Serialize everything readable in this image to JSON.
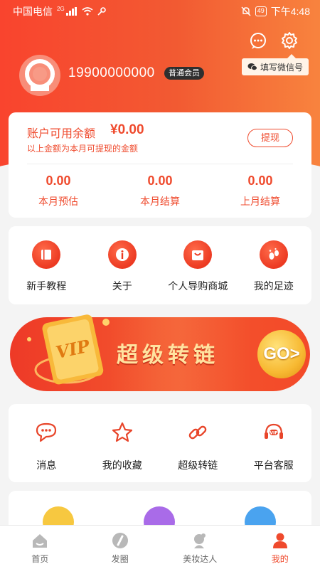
{
  "status_bar": {
    "carrier": "中国电信",
    "network": "2G",
    "battery": "49",
    "time": "下午4:48"
  },
  "header": {
    "wechat_button_label": "填写微信号",
    "phone": "19900000000",
    "member_badge": "普通会员"
  },
  "balance": {
    "title": "账户可用余额",
    "amount": "¥0.00",
    "note": "以上金额为本月可提现的金额",
    "withdraw_label": "提现",
    "stats": [
      {
        "value": "0.00",
        "label": "本月预估"
      },
      {
        "value": "0.00",
        "label": "本月结算"
      },
      {
        "value": "0.00",
        "label": "上月结算"
      }
    ]
  },
  "menu_top": [
    {
      "label": "新手教程",
      "icon": "book-icon"
    },
    {
      "label": "关于",
      "icon": "info-icon"
    },
    {
      "label": "个人导购商城",
      "icon": "shopping-bag-icon"
    },
    {
      "label": "我的足迹",
      "icon": "footprint-icon"
    }
  ],
  "banner": {
    "title": "超级转链",
    "vip_text": "VIP",
    "go_text": "GO>"
  },
  "menu_bottom": [
    {
      "label": "消息",
      "icon": "chat-bubble-icon"
    },
    {
      "label": "我的收藏",
      "icon": "star-icon"
    },
    {
      "label": "超级转链",
      "icon": "link-icon"
    },
    {
      "label": "平台客服",
      "icon": "headset-icon"
    }
  ],
  "tabbar": [
    {
      "label": "首页",
      "icon": "home-icon",
      "active": false
    },
    {
      "label": "发圈",
      "icon": "compass-icon",
      "active": false
    },
    {
      "label": "美妆达人",
      "icon": "beauty-icon",
      "active": false
    },
    {
      "label": "我的",
      "icon": "person-icon",
      "active": true
    }
  ],
  "colors": {
    "primary": "#ef4a2d",
    "badge_bg": "#2f2f2f",
    "gold": "#f7b932"
  }
}
